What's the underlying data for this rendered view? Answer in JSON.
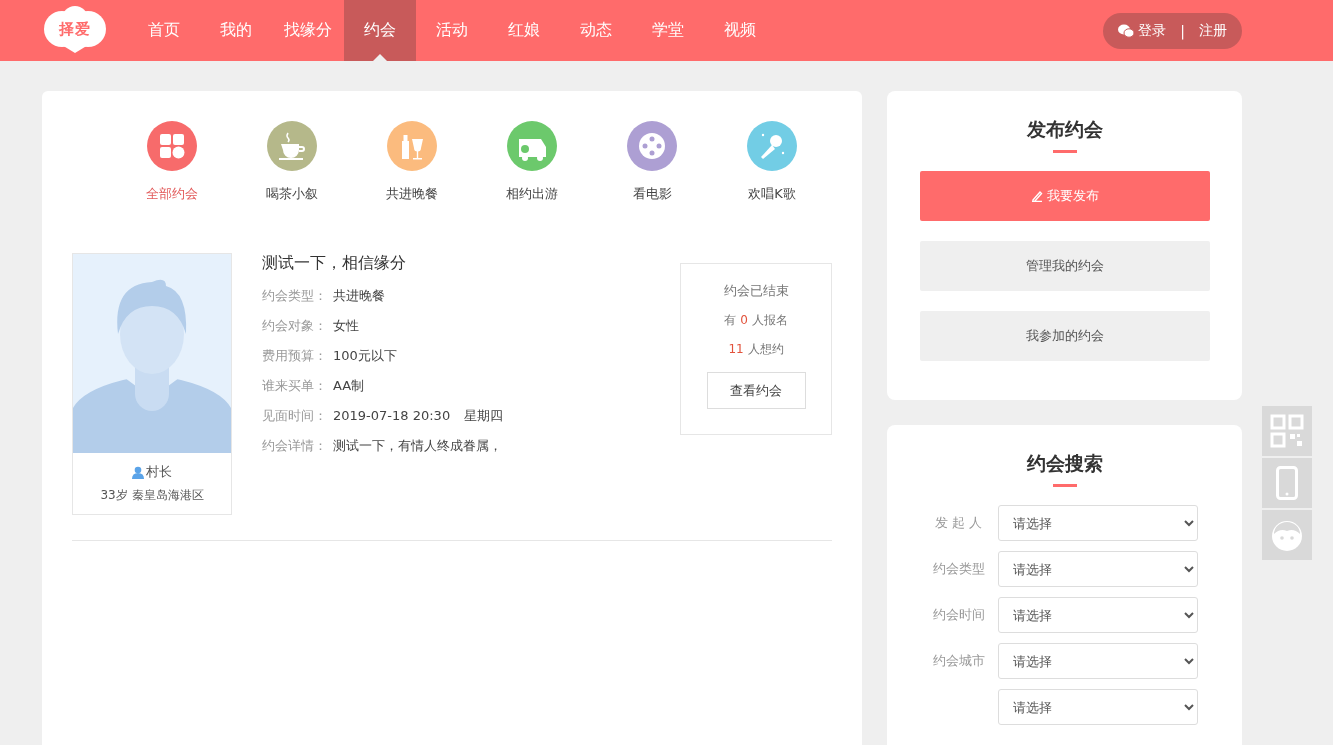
{
  "header": {
    "logo": "择爱",
    "nav": [
      {
        "label": "首页",
        "selected": false
      },
      {
        "label": "我的",
        "selected": false
      },
      {
        "label": "找缘分",
        "selected": false
      },
      {
        "label": "约会",
        "selected": true
      },
      {
        "label": "活动",
        "selected": false
      },
      {
        "label": "红娘",
        "selected": false
      },
      {
        "label": "动态",
        "selected": false
      },
      {
        "label": "学堂",
        "selected": false
      },
      {
        "label": "视频",
        "selected": false
      }
    ],
    "auth": {
      "login": "登录",
      "separator": "|",
      "register": "注册"
    }
  },
  "categories": [
    {
      "label": "全部约会",
      "kind": "all",
      "color": "#f76b6b",
      "selected": true
    },
    {
      "label": "喝茶小叙",
      "kind": "tea",
      "color": "#b5b88a",
      "selected": false
    },
    {
      "label": "共进晚餐",
      "kind": "dinner",
      "color": "#fbbb7e",
      "selected": false
    },
    {
      "label": "相约出游",
      "kind": "travel",
      "color": "#6cc96c",
      "selected": false
    },
    {
      "label": "看电影",
      "kind": "movie",
      "color": "#ad9fd3",
      "selected": false
    },
    {
      "label": "欢唱K歌",
      "kind": "karaoke",
      "color": "#72cde5",
      "selected": false
    }
  ],
  "date": {
    "title": "测试一下，相信缘分",
    "fields": [
      {
        "label": "约会类型：",
        "value": "共进晚餐"
      },
      {
        "label": "约会对象：",
        "value": "女性"
      },
      {
        "label": "费用预算：",
        "value": "100元以下"
      },
      {
        "label": "谁来买单：",
        "value": "AA制"
      },
      {
        "label": "见面时间：",
        "value": "2019-07-18 20:30",
        "extra": "星期四"
      },
      {
        "label": "约会详情：",
        "value": "测试一下，有情人终成眷属，"
      }
    ],
    "user": {
      "name": "村长",
      "info": "33岁 秦皇岛海港区"
    },
    "status": {
      "title": "约会已结束",
      "signup_prefix": "有",
      "signup_count": "0",
      "signup_suffix": "人报名",
      "interest_count": "11",
      "interest_suffix": "人想约",
      "button": "查看约会"
    }
  },
  "publish": {
    "title": "发布约会",
    "buttons": [
      {
        "label": "我要发布",
        "kind": "primary"
      },
      {
        "label": "管理我的约会",
        "kind": "secondary"
      },
      {
        "label": "我参加的约会",
        "kind": "secondary"
      }
    ]
  },
  "search": {
    "title": "约会搜索",
    "fields": [
      {
        "label": "发 起 人",
        "value": "请选择"
      },
      {
        "label": "约会类型",
        "value": "请选择"
      },
      {
        "label": "约会时间",
        "value": "请选择"
      },
      {
        "label": "约会城市",
        "value": "请选择"
      },
      {
        "value": "请选择"
      }
    ]
  },
  "side_tools": [
    {
      "kind": "qr"
    },
    {
      "kind": "phone"
    },
    {
      "kind": "service"
    }
  ]
}
